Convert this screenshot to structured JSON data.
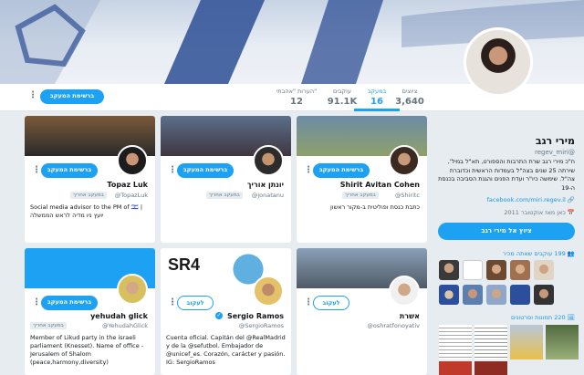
{
  "profile": {
    "name": "מירי רגב",
    "handle": "@regev_miri",
    "bio": "ח\"כ מירי רגב שרת התרבות והספורט, תא\"ל במיל', שירתה 25 שנים בצה\"ל בעמדות הראשית וכדוברת צה\"ל. שימשה כיו\"ר ועדת הפנים והגנת הסביבה בכנסת ה-19",
    "link": "facebook.com/miri.regev.il",
    "joined": "כאן מאז אוקטובר 2011",
    "tweet_to_label": "ציוץ אל מירי רגב",
    "followers_you_know": "199 עוקבים שאתה מכיר",
    "media_label": "220 תמונות וסרטונים"
  },
  "nav": {
    "stats": [
      {
        "label": "ציוצים",
        "value": "3,640"
      },
      {
        "label": "במעקב",
        "value": "16"
      },
      {
        "label": "עוקבים",
        "value": "91.1K"
      },
      {
        "label": "הערות \"אהבתי\"",
        "value": "12"
      }
    ],
    "follow_button": "ברשימת המעקב"
  },
  "cards": [
    {
      "name": "Shirit Avitan Cohen",
      "handle": "@Shiritc",
      "follows_you": "במעקב אחריך",
      "bio": "כתבת כנסת ופוליטית ב-מקור ראשון",
      "button": "ברשימת המעקב"
    },
    {
      "name": "יונתן אוריך",
      "handle": "@jonatanu",
      "follows_you": "במעקב אחריך",
      "bio": "",
      "button": "ברשימת המעקב"
    },
    {
      "name": "Topaz Luk",
      "handle": "@TopazLuk",
      "follows_you": "במעקב אחריך",
      "bio": "Social media advisor to the PM of 🇮🇱 | יועץ ניו מדיה לראש הממשלה",
      "button": "ברשימת המעקב"
    },
    {
      "name": "אשרת",
      "handle": "@oshratfonoyativ",
      "follows_you": "",
      "bio": "",
      "button": "לעקוב"
    },
    {
      "name": "Sergio Ramos",
      "handle": "@SergioRamos",
      "follows_you": "",
      "bio": "Cuenta oficial. Capitán del @RealMadrid y de la @sefutbol. Embajador de @unicef_es. Corazón, carácter y pasión. IG: SergioRamos",
      "button": "לעקוב",
      "cover_text": "SR4"
    },
    {
      "name": "yehudah glick",
      "handle": "@YehudahGlick",
      "follows_you": "במעקב אחריך",
      "bio": "Member of Likud party in the israeli parliament (Knesset). Name of office - Jerusalem of Shalom (peace,harmony,diversity)",
      "button": "ברשימת המעקב"
    }
  ],
  "colors": {
    "accent": "#1da1f2",
    "background": "#e6ecf0"
  }
}
